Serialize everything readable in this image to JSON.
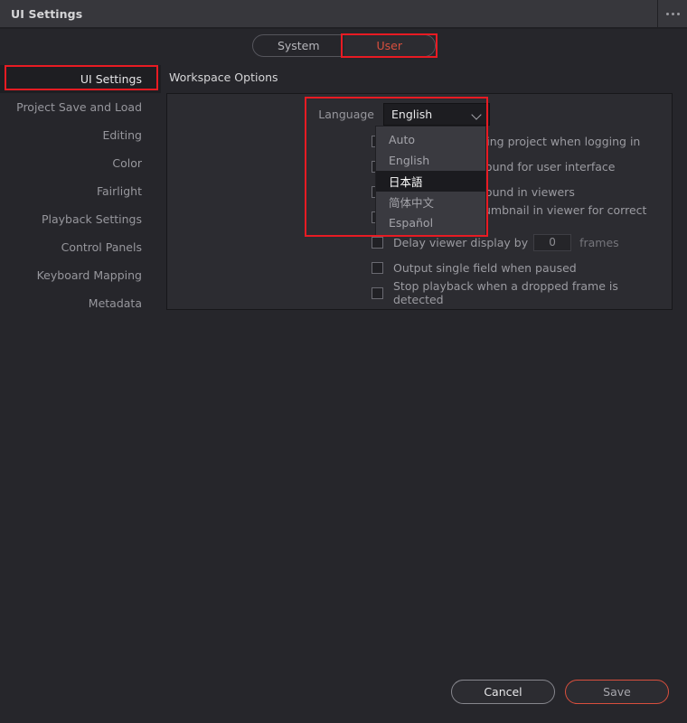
{
  "window": {
    "title": "UI Settings",
    "menu_icon": "ellipsis-icon"
  },
  "tabs": [
    {
      "label": "System",
      "active": false
    },
    {
      "label": "User",
      "active": true
    }
  ],
  "sidebar": {
    "items": [
      {
        "label": "UI Settings",
        "selected": true
      },
      {
        "label": "Project Save and Load",
        "selected": false
      },
      {
        "label": "Editing",
        "selected": false
      },
      {
        "label": "Color",
        "selected": false
      },
      {
        "label": "Fairlight",
        "selected": false
      },
      {
        "label": "Playback Settings",
        "selected": false
      },
      {
        "label": "Control Panels",
        "selected": false
      },
      {
        "label": "Keyboard Mapping",
        "selected": false
      },
      {
        "label": "Metadata",
        "selected": false
      }
    ]
  },
  "main": {
    "section_title": "Workspace Options",
    "language": {
      "label": "Language",
      "selected_value": "English",
      "chevron_icon": "chevron-down-icon",
      "dropdown_open": true,
      "options": [
        {
          "label": "Auto",
          "highlighted": false
        },
        {
          "label": "English",
          "highlighted": false
        },
        {
          "label": "日本語",
          "highlighted": true
        },
        {
          "label": "简体中文",
          "highlighted": false
        },
        {
          "label": "Español",
          "highlighted": false
        }
      ]
    },
    "options": [
      {
        "label": "Reload last working project when logging in",
        "checked": false,
        "type": "checkbox"
      },
      {
        "label": "Use gray background for user interface",
        "checked": false,
        "type": "checkbox"
      },
      {
        "label": "Use gray background in viewers",
        "checked": false,
        "type": "checkbox"
      },
      {
        "label": "Stretch video thumbnail in viewer for correct aspect ratio",
        "checked": false,
        "type": "checkbox"
      },
      {
        "label": "Delay viewer display by",
        "checked": false,
        "type": "checkbox-number",
        "value": "0",
        "unit": "frames"
      },
      {
        "label": "Output single field when paused",
        "checked": false,
        "type": "checkbox"
      },
      {
        "label": "Stop playback when a dropped frame is detected",
        "checked": false,
        "type": "checkbox"
      }
    ]
  },
  "footer": {
    "cancel_label": "Cancel",
    "save_label": "Save"
  },
  "colors": {
    "background": "#26262b",
    "titlebar": "#37373c",
    "panel": "#2c2c31",
    "accent_red": "#d94f3d",
    "annotation_red": "#e81b23"
  }
}
